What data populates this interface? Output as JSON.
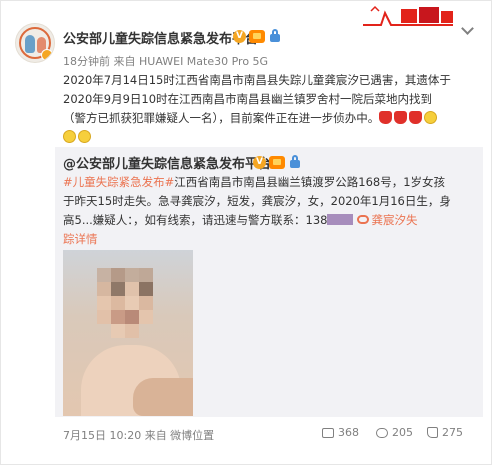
{
  "post": {
    "author": "公安部儿童失踪信息紧急发布平台",
    "meta": "18分钟前 来自 HUAWEI Mate30 Pro 5G",
    "lines": [
      "2020年7月14日15时江西省南昌市南昌县失踪儿童龚宸汐已遇害，其遗体于",
      "2020年9月9日10时在江西南昌市南昌县幽兰镇罗舍村一院后菜地内找到",
      "（警方已抓获犯罪嫌疑人一名），目前案件正在进一步侦办中。"
    ],
    "icons": [
      "verified-icon",
      "vip-icon",
      "lock-icon",
      "chevron-down-icon",
      "candle-emoji",
      "cry-emoji",
      "festive-banner"
    ]
  },
  "repost": {
    "author": "@公安部儿童失踪信息紧急发布平台",
    "hashtag": "#儿童失踪紧急发布#",
    "line1_rest": "江西省南昌市南昌县幽兰镇渡罗公路168号，1岁女孩",
    "line2": "于昨天15时走失。急寻龚宸汐，短发，龚宸汐，女，2020年1月16日生，身",
    "line3_text": "高5...嫌疑人：，如有线索，请迅速与警方联系：138",
    "line3_link": "龚宸汐失",
    "line4_link": "踪详情"
  },
  "footer": {
    "time": "7月15日 10:20 来自 微博位置",
    "share_count": "368",
    "comment_count": "205",
    "like_count": "275"
  },
  "colors": {
    "link": "#eb7350",
    "repost_bg": "#f2f2f5",
    "meta": "#808080"
  }
}
